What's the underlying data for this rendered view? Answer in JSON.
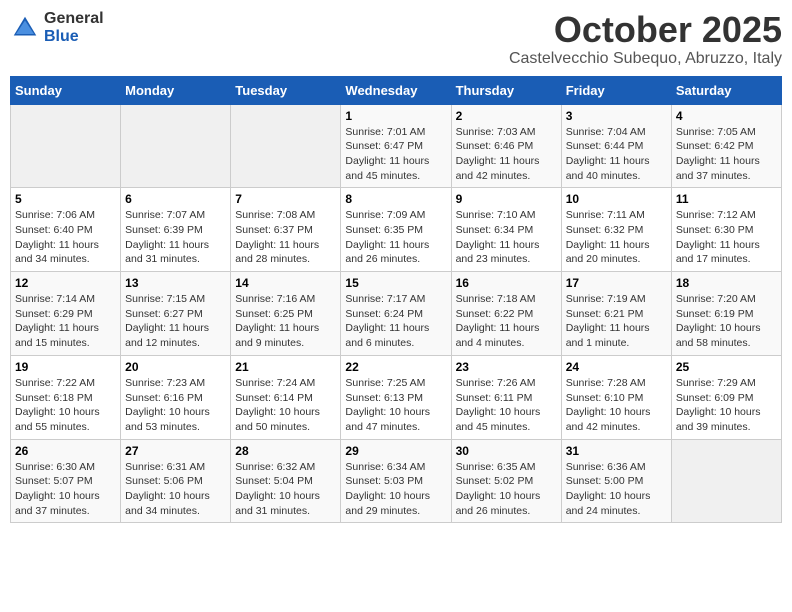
{
  "logo": {
    "general": "General",
    "blue": "Blue"
  },
  "title": "October 2025",
  "subtitle": "Castelvecchio Subequo, Abruzzo, Italy",
  "days_of_week": [
    "Sunday",
    "Monday",
    "Tuesday",
    "Wednesday",
    "Thursday",
    "Friday",
    "Saturday"
  ],
  "weeks": [
    [
      {
        "day": "",
        "info": ""
      },
      {
        "day": "",
        "info": ""
      },
      {
        "day": "",
        "info": ""
      },
      {
        "day": "1",
        "info": "Sunrise: 7:01 AM\nSunset: 6:47 PM\nDaylight: 11 hours and 45 minutes."
      },
      {
        "day": "2",
        "info": "Sunrise: 7:03 AM\nSunset: 6:46 PM\nDaylight: 11 hours and 42 minutes."
      },
      {
        "day": "3",
        "info": "Sunrise: 7:04 AM\nSunset: 6:44 PM\nDaylight: 11 hours and 40 minutes."
      },
      {
        "day": "4",
        "info": "Sunrise: 7:05 AM\nSunset: 6:42 PM\nDaylight: 11 hours and 37 minutes."
      }
    ],
    [
      {
        "day": "5",
        "info": "Sunrise: 7:06 AM\nSunset: 6:40 PM\nDaylight: 11 hours and 34 minutes."
      },
      {
        "day": "6",
        "info": "Sunrise: 7:07 AM\nSunset: 6:39 PM\nDaylight: 11 hours and 31 minutes."
      },
      {
        "day": "7",
        "info": "Sunrise: 7:08 AM\nSunset: 6:37 PM\nDaylight: 11 hours and 28 minutes."
      },
      {
        "day": "8",
        "info": "Sunrise: 7:09 AM\nSunset: 6:35 PM\nDaylight: 11 hours and 26 minutes."
      },
      {
        "day": "9",
        "info": "Sunrise: 7:10 AM\nSunset: 6:34 PM\nDaylight: 11 hours and 23 minutes."
      },
      {
        "day": "10",
        "info": "Sunrise: 7:11 AM\nSunset: 6:32 PM\nDaylight: 11 hours and 20 minutes."
      },
      {
        "day": "11",
        "info": "Sunrise: 7:12 AM\nSunset: 6:30 PM\nDaylight: 11 hours and 17 minutes."
      }
    ],
    [
      {
        "day": "12",
        "info": "Sunrise: 7:14 AM\nSunset: 6:29 PM\nDaylight: 11 hours and 15 minutes."
      },
      {
        "day": "13",
        "info": "Sunrise: 7:15 AM\nSunset: 6:27 PM\nDaylight: 11 hours and 12 minutes."
      },
      {
        "day": "14",
        "info": "Sunrise: 7:16 AM\nSunset: 6:25 PM\nDaylight: 11 hours and 9 minutes."
      },
      {
        "day": "15",
        "info": "Sunrise: 7:17 AM\nSunset: 6:24 PM\nDaylight: 11 hours and 6 minutes."
      },
      {
        "day": "16",
        "info": "Sunrise: 7:18 AM\nSunset: 6:22 PM\nDaylight: 11 hours and 4 minutes."
      },
      {
        "day": "17",
        "info": "Sunrise: 7:19 AM\nSunset: 6:21 PM\nDaylight: 11 hours and 1 minute."
      },
      {
        "day": "18",
        "info": "Sunrise: 7:20 AM\nSunset: 6:19 PM\nDaylight: 10 hours and 58 minutes."
      }
    ],
    [
      {
        "day": "19",
        "info": "Sunrise: 7:22 AM\nSunset: 6:18 PM\nDaylight: 10 hours and 55 minutes."
      },
      {
        "day": "20",
        "info": "Sunrise: 7:23 AM\nSunset: 6:16 PM\nDaylight: 10 hours and 53 minutes."
      },
      {
        "day": "21",
        "info": "Sunrise: 7:24 AM\nSunset: 6:14 PM\nDaylight: 10 hours and 50 minutes."
      },
      {
        "day": "22",
        "info": "Sunrise: 7:25 AM\nSunset: 6:13 PM\nDaylight: 10 hours and 47 minutes."
      },
      {
        "day": "23",
        "info": "Sunrise: 7:26 AM\nSunset: 6:11 PM\nDaylight: 10 hours and 45 minutes."
      },
      {
        "day": "24",
        "info": "Sunrise: 7:28 AM\nSunset: 6:10 PM\nDaylight: 10 hours and 42 minutes."
      },
      {
        "day": "25",
        "info": "Sunrise: 7:29 AM\nSunset: 6:09 PM\nDaylight: 10 hours and 39 minutes."
      }
    ],
    [
      {
        "day": "26",
        "info": "Sunrise: 6:30 AM\nSunset: 5:07 PM\nDaylight: 10 hours and 37 minutes."
      },
      {
        "day": "27",
        "info": "Sunrise: 6:31 AM\nSunset: 5:06 PM\nDaylight: 10 hours and 34 minutes."
      },
      {
        "day": "28",
        "info": "Sunrise: 6:32 AM\nSunset: 5:04 PM\nDaylight: 10 hours and 31 minutes."
      },
      {
        "day": "29",
        "info": "Sunrise: 6:34 AM\nSunset: 5:03 PM\nDaylight: 10 hours and 29 minutes."
      },
      {
        "day": "30",
        "info": "Sunrise: 6:35 AM\nSunset: 5:02 PM\nDaylight: 10 hours and 26 minutes."
      },
      {
        "day": "31",
        "info": "Sunrise: 6:36 AM\nSunset: 5:00 PM\nDaylight: 10 hours and 24 minutes."
      },
      {
        "day": "",
        "info": ""
      }
    ]
  ]
}
